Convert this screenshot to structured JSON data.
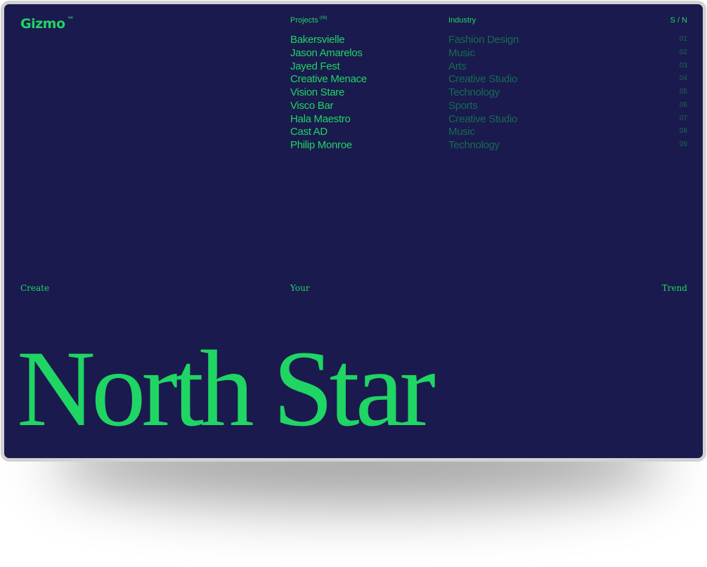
{
  "brand": {
    "name": "Gizmo",
    "trademark": "™"
  },
  "header": {
    "projects_label": "Projects",
    "projects_count": "(09)",
    "industry_label": "Industry",
    "sn_label": "S / N"
  },
  "projects": [
    {
      "name": "Bakersvielle",
      "industry": "Fashion Design",
      "sn": "01"
    },
    {
      "name": "Jason Amarelos",
      "industry": "Music",
      "sn": "02"
    },
    {
      "name": "Jayed Fest",
      "industry": "Arts",
      "sn": "03"
    },
    {
      "name": "Creative Menace",
      "industry": "Creative Studio",
      "sn": "04"
    },
    {
      "name": "Vision Stare",
      "industry": "Technology",
      "sn": "05"
    },
    {
      "name": "Visco Bar",
      "industry": "Sports",
      "sn": "06"
    },
    {
      "name": "Hala Maestro",
      "industry": "Creative Studio",
      "sn": "07"
    },
    {
      "name": "Cast AD",
      "industry": "Music",
      "sn": "08"
    },
    {
      "name": "Philip Monroe",
      "industry": "Technology",
      "sn": "09"
    }
  ],
  "tagline": {
    "word_1": "Create",
    "word_2": "Your",
    "word_3": "Trend"
  },
  "hero": {
    "title": "North Star"
  },
  "colors": {
    "background": "#1a1a4e",
    "accent": "#1fd563",
    "muted": "#166b52",
    "frame_border": "#d2d2d2"
  }
}
